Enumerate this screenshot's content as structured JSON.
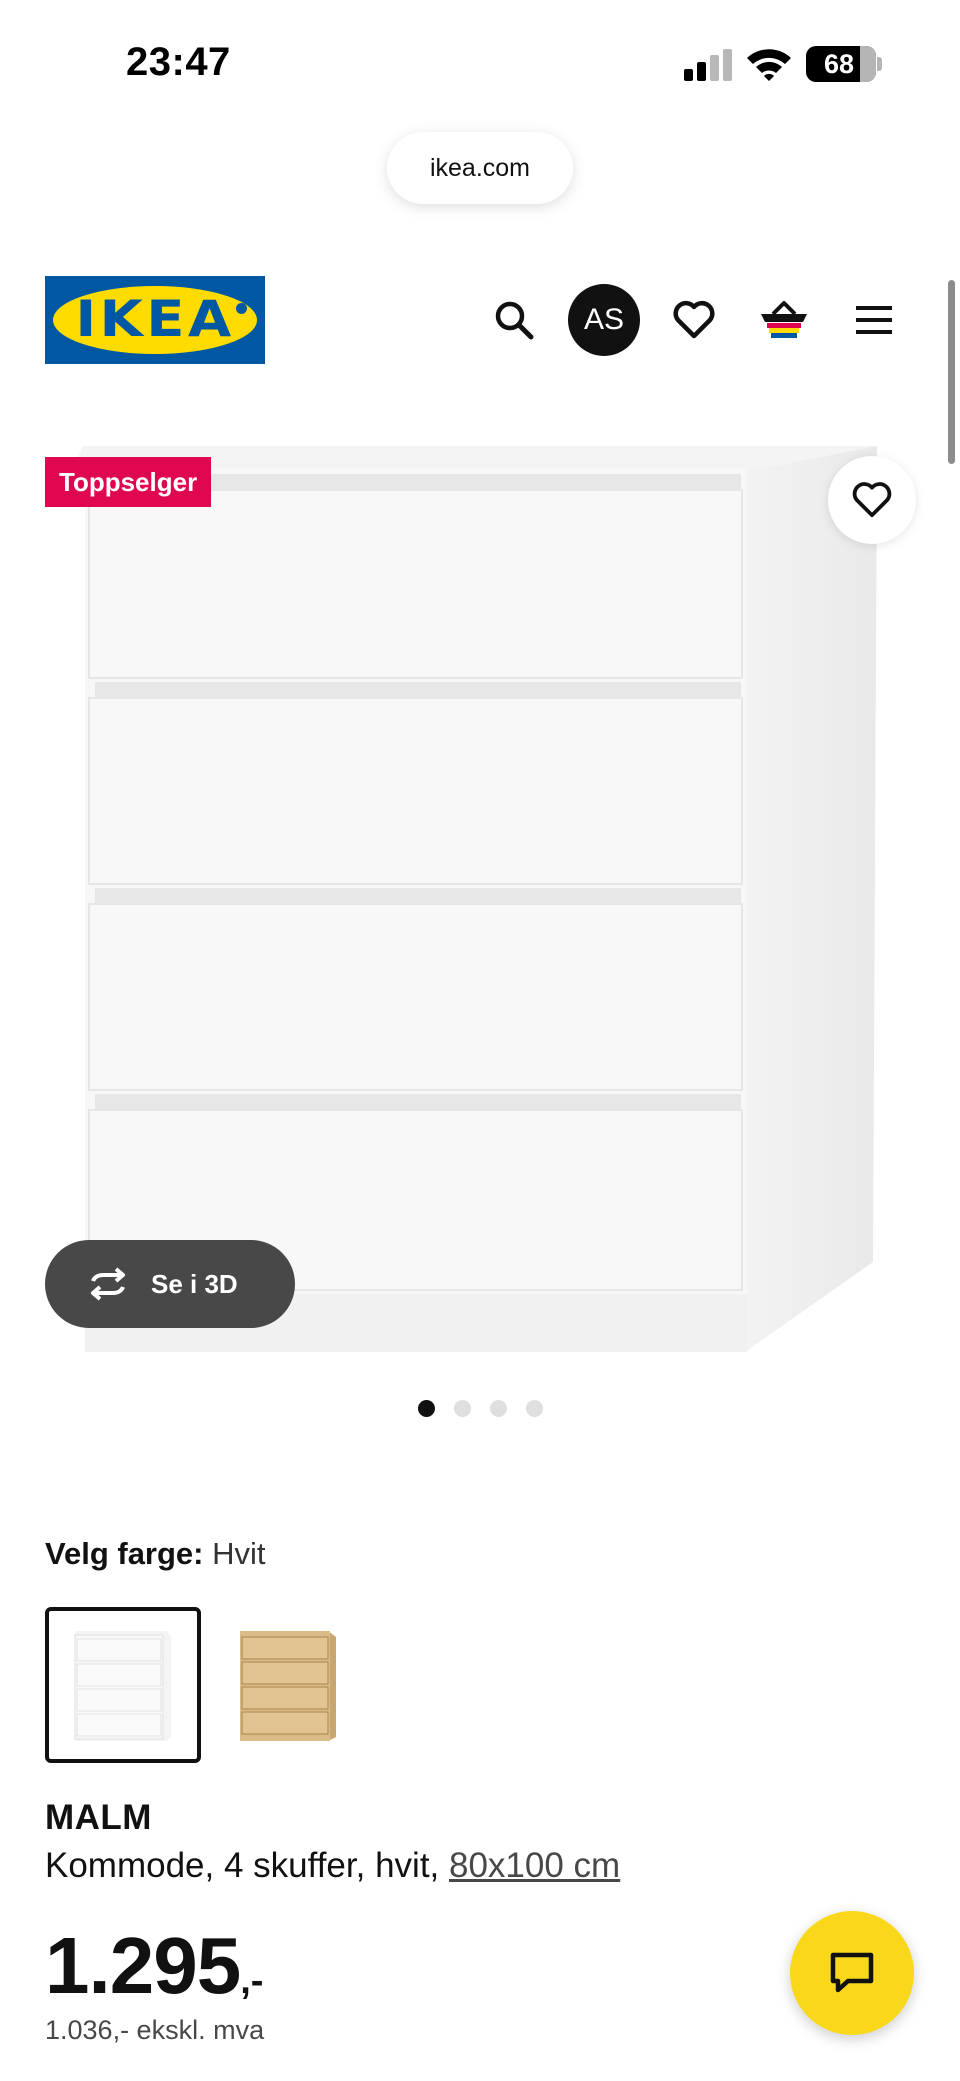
{
  "status_bar": {
    "time": "23:47",
    "battery_level": "68",
    "signal_bars_active": 2,
    "signal_bars_total": 4
  },
  "browser": {
    "url": "ikea.com"
  },
  "header": {
    "logo_text": "IKEA",
    "avatar_initials": "AS",
    "icons": [
      "search-icon",
      "heart-icon",
      "basket-icon",
      "menu-icon"
    ]
  },
  "product_media": {
    "badge": "Toppselger",
    "view_3d_label": "Se i 3D",
    "image_count": 4,
    "active_image_index": 0
  },
  "color_selection": {
    "label": "Velg farge:",
    "selected_value": "Hvit",
    "options": [
      {
        "name": "hvit",
        "selected": true
      },
      {
        "name": "oak",
        "selected": false
      }
    ]
  },
  "product": {
    "name": "MALM",
    "description": "Kommode, 4 skuffer, hvit,",
    "size": "80x100 cm",
    "price_main": "1.295",
    "price_suffix": ",-",
    "price_ex_vat": "1.036,- ekskl. mva"
  },
  "colors": {
    "ikea_blue": "#0058a3",
    "ikea_yellow": "#ffdb00",
    "badge_red": "#e00751",
    "chat_yellow": "#f9d81c",
    "dark_pill": "#484848"
  }
}
